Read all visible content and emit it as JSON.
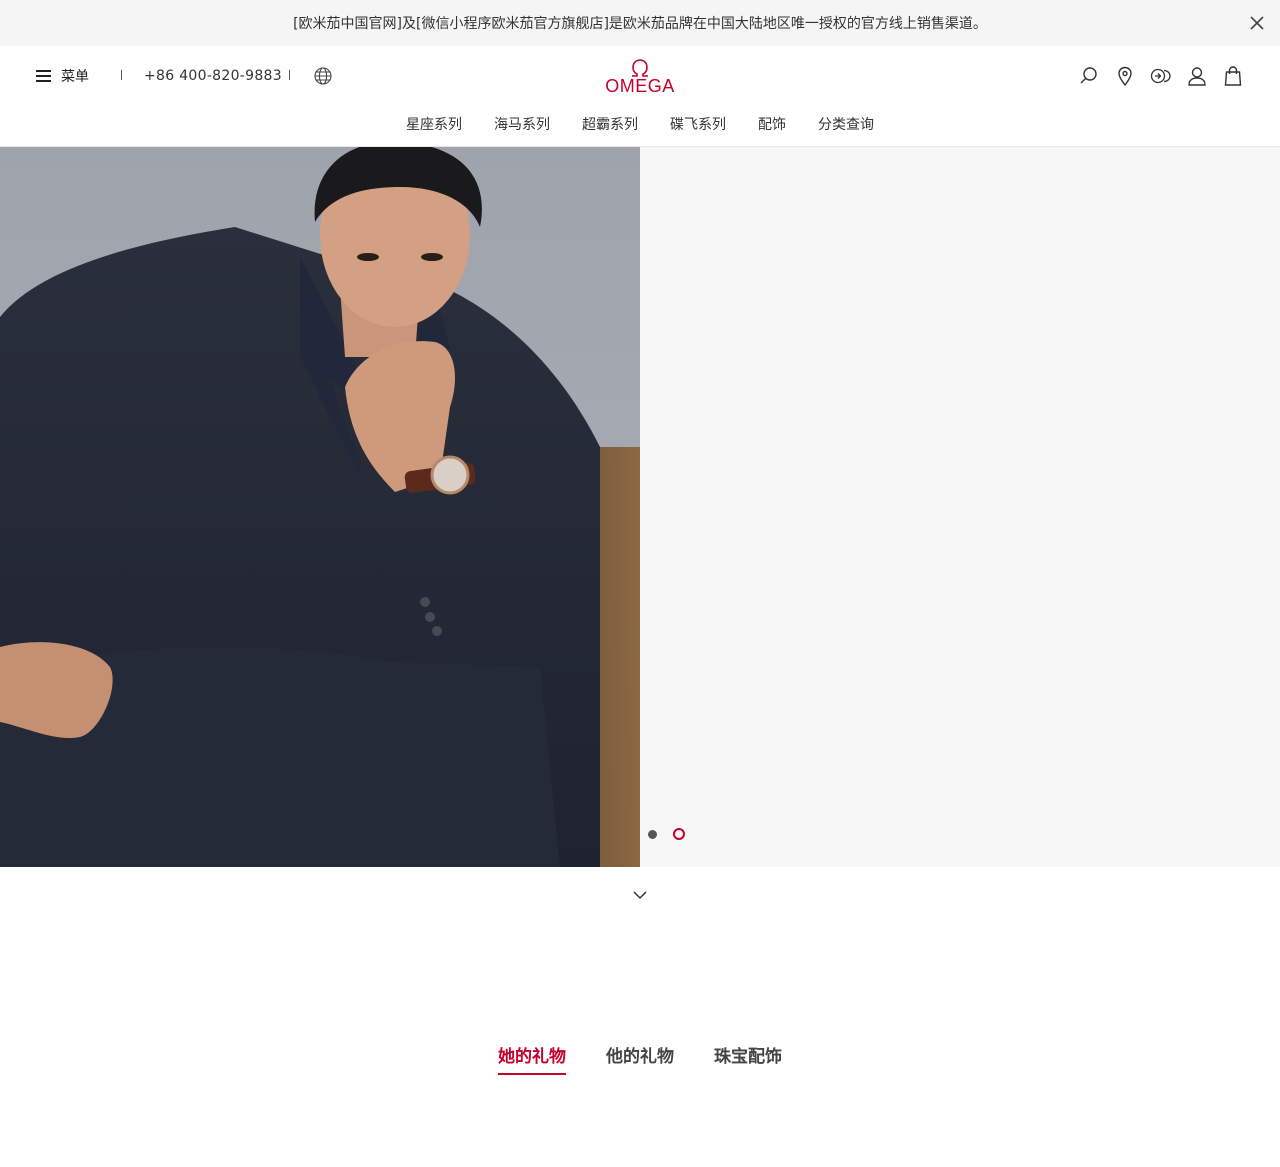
{
  "announcement": {
    "text": "[欧米茄中国官网]及[微信小程序欧米茄官方旗舰店]是欧米茄品牌在中国大陆地区唯一授权的官方线上销售渠道。"
  },
  "header": {
    "menu_label": "菜单",
    "phone": "+86 400-820-9883",
    "logo_text": "OMEGA",
    "nav": [
      "星座系列",
      "海马系列",
      "超霸系列",
      "碟飞系列",
      "配饰",
      "分类查询"
    ]
  },
  "hero": {
    "slides_total": 2,
    "active_slide": 2
  },
  "gift_tabs": {
    "items": [
      "她的礼物",
      "他的礼物",
      "珠宝配饰"
    ],
    "active": "她的礼物"
  },
  "colors": {
    "brand_red": "#c4002b",
    "announcement_bg": "#f5f5f5",
    "hero_right_bg": "#f7f7f7"
  },
  "icons": [
    "close-icon",
    "hamburger-icon",
    "globe-icon",
    "omega-logo",
    "search-icon",
    "location-pin-icon",
    "chat-icon",
    "account-icon",
    "shopping-bag-icon",
    "chevron-down-icon"
  ]
}
